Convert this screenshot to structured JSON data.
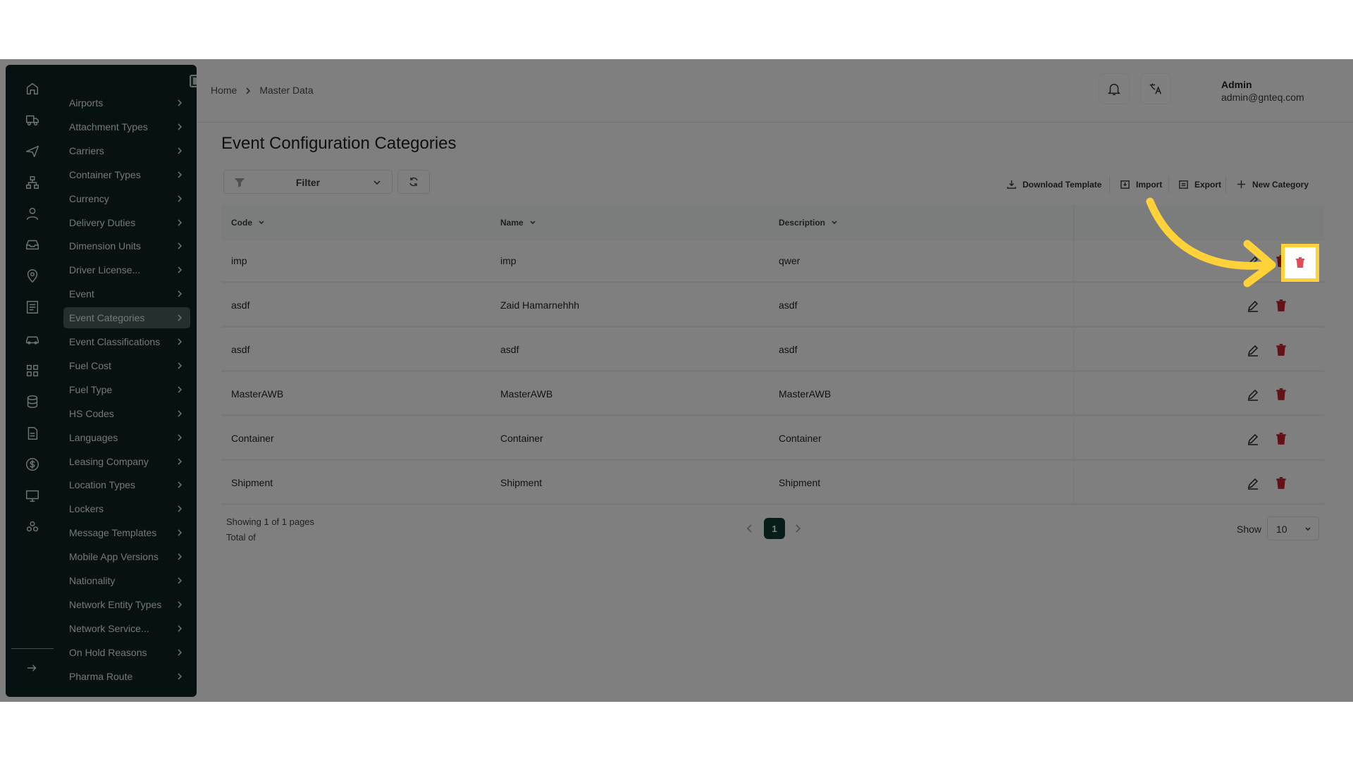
{
  "sidebar": {
    "rail_icons": [
      "home-icon",
      "truck-icon",
      "plane-icon",
      "network-icon",
      "user-icon",
      "inbox-icon",
      "location-pin-icon",
      "report-icon",
      "car-icon",
      "grid-icon",
      "database-icon",
      "document-icon",
      "dollar-icon",
      "monitor-icon",
      "cluster-icon",
      "logout-icon"
    ],
    "items": [
      {
        "label": "Airports"
      },
      {
        "label": "Attachment Types"
      },
      {
        "label": "Carriers"
      },
      {
        "label": "Container Types"
      },
      {
        "label": "Currency"
      },
      {
        "label": "Delivery Duties"
      },
      {
        "label": "Dimension Units"
      },
      {
        "label": "Driver License..."
      },
      {
        "label": "Event"
      },
      {
        "label": "Event Categories",
        "active": true
      },
      {
        "label": "Event Classifications"
      },
      {
        "label": "Fuel Cost"
      },
      {
        "label": "Fuel Type"
      },
      {
        "label": "HS Codes"
      },
      {
        "label": "Languages"
      },
      {
        "label": "Leasing Company"
      },
      {
        "label": "Location Types"
      },
      {
        "label": "Lockers"
      },
      {
        "label": "Message Templates"
      },
      {
        "label": "Mobile App Versions"
      },
      {
        "label": "Nationality"
      },
      {
        "label": "Network Entity Types"
      },
      {
        "label": "Network Service..."
      },
      {
        "label": "On Hold Reasons"
      },
      {
        "label": "Pharma Route"
      }
    ]
  },
  "breadcrumb": {
    "home": "Home",
    "current": "Master Data"
  },
  "user": {
    "name": "Admin",
    "email": "admin@gnteq.com"
  },
  "page": {
    "title": "Event Configuration Categories"
  },
  "toolbar": {
    "filter_label": "Filter",
    "download_template": "Download Template",
    "import": "Import",
    "export": "Export",
    "new_category": "New Category"
  },
  "table": {
    "columns": [
      "Code",
      "Name",
      "Description"
    ],
    "rows": [
      {
        "code": "imp",
        "name": "imp",
        "description": "qwer"
      },
      {
        "code": "asdf",
        "name": "Zaid Hamarnehhh",
        "description": "asdf"
      },
      {
        "code": "asdf",
        "name": "asdf",
        "description": "asdf"
      },
      {
        "code": "MasterAWB",
        "name": "MasterAWB",
        "description": "MasterAWB"
      },
      {
        "code": "Container",
        "name": "Container",
        "description": "Container"
      },
      {
        "code": "Shipment",
        "name": "Shipment",
        "description": "Shipment"
      }
    ]
  },
  "pagination": {
    "showing": "Showing 1 of 1 pages",
    "total": "Total of",
    "current_page": "1",
    "show_label": "Show",
    "page_size": "10"
  },
  "colors": {
    "sidebar_bg": "#0a2422",
    "accent": "#0e3a34",
    "delete": "#c9222a",
    "highlight": "#ffd23a"
  }
}
